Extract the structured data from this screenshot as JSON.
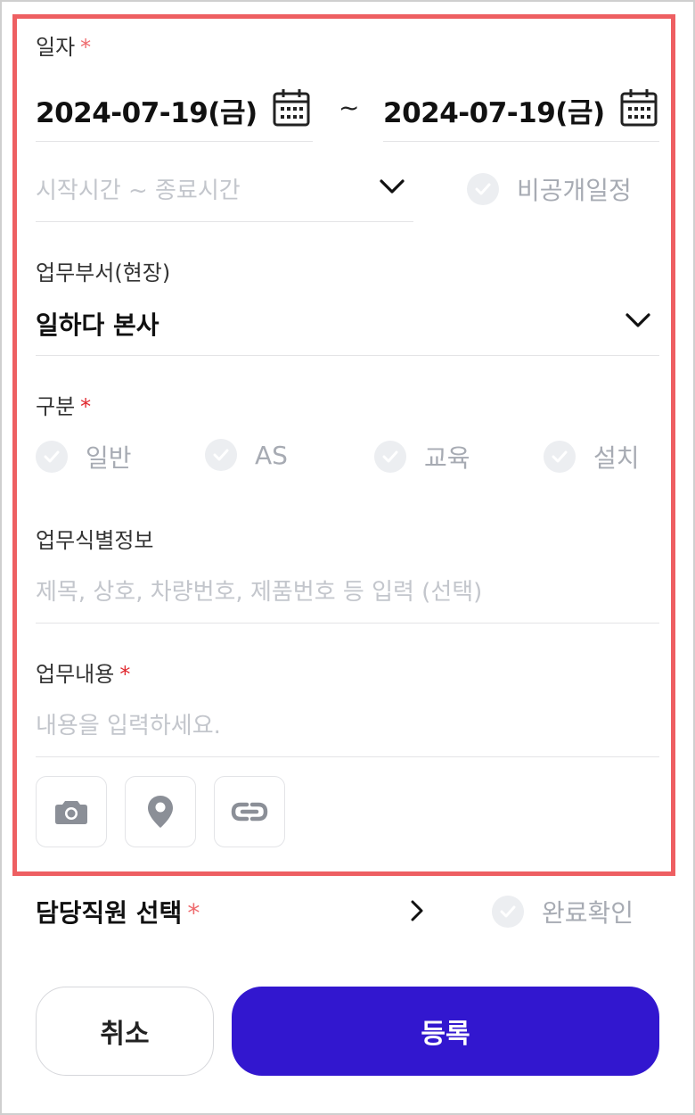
{
  "date_section": {
    "label": "일자",
    "required_mark": "*",
    "start_date": "2024-07-19(금)",
    "separator": "~",
    "end_date": "2024-07-19(금)"
  },
  "time_section": {
    "placeholder": "시작시간  ~ 종료시간",
    "private_label": "비공개일정"
  },
  "department": {
    "label": "업무부서(현장)",
    "value": "일하다 본사"
  },
  "category": {
    "label": "구분",
    "required_mark": "*",
    "options": [
      "일반",
      "AS",
      "교육",
      "설치"
    ]
  },
  "identifier": {
    "label": "업무식별정보",
    "placeholder": "제목, 상호, 차량번호, 제품번호 등 입력 (선택)"
  },
  "content": {
    "label": "업무내용",
    "required_mark": "*",
    "placeholder": "내용을 입력하세요."
  },
  "attachments": {
    "icons": [
      "camera-icon",
      "location-pin-icon",
      "link-icon"
    ]
  },
  "assignee": {
    "label": "담당직원 선택",
    "required_mark": "*",
    "complete_label": "완료확인"
  },
  "actions": {
    "cancel_label": "취소",
    "register_label": "등록"
  },
  "colors": {
    "primary": "#3217cf",
    "highlight_border": "#ee5f62",
    "required": "#e0282e",
    "placeholder": "#c3c6cc"
  }
}
